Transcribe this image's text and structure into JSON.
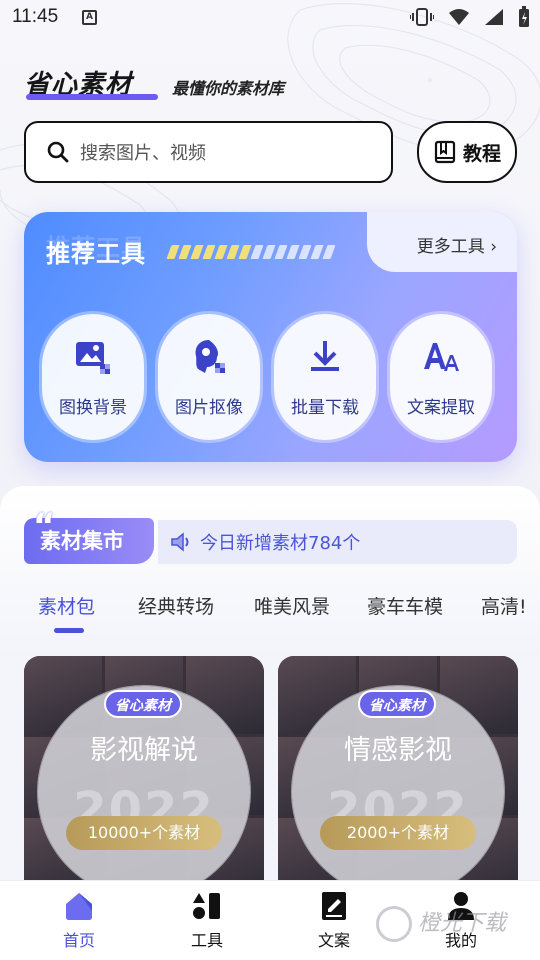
{
  "status_bar": {
    "time": "11:45",
    "notif_letter": "A"
  },
  "header": {
    "logo": "省心素材",
    "slogan": "最懂你的素材库"
  },
  "search": {
    "placeholder": "搜索图片、视频"
  },
  "tutorial_label": "教程",
  "tools": {
    "title": "推荐工具",
    "more": "更多工具 ›",
    "items": [
      {
        "label": "图换背景",
        "icon": "image-replace-icon"
      },
      {
        "label": "图片抠像",
        "icon": "portrait-cutout-icon"
      },
      {
        "label": "批量下载",
        "icon": "download-icon"
      },
      {
        "label": "文案提取",
        "icon": "text-extract-icon"
      }
    ]
  },
  "materials": {
    "title": "素材集市",
    "notice": "今日新增素材784个",
    "categories": [
      "素材包",
      "经典转场",
      "唯美风景",
      "豪车车模",
      "高清!"
    ]
  },
  "collections": [
    {
      "badge": "省心素材",
      "title": "影视解说",
      "year": "2022",
      "count": "10000+个素材"
    },
    {
      "badge": "省心素材",
      "title": "情感影视",
      "year": "2022",
      "count": "2000+个素材"
    }
  ],
  "nav": [
    {
      "label": "首页",
      "icon": "home-icon",
      "active": true
    },
    {
      "label": "工具",
      "icon": "tools-icon",
      "active": false
    },
    {
      "label": "文案",
      "icon": "notebook-icon",
      "active": false
    },
    {
      "label": "我的",
      "icon": "profile-icon",
      "active": false
    }
  ],
  "watermark": "橙光下载",
  "colors": {
    "accent": "#4a52d8",
    "brand_purple": "#6d6cf0",
    "gold": "#c9ad6a"
  }
}
